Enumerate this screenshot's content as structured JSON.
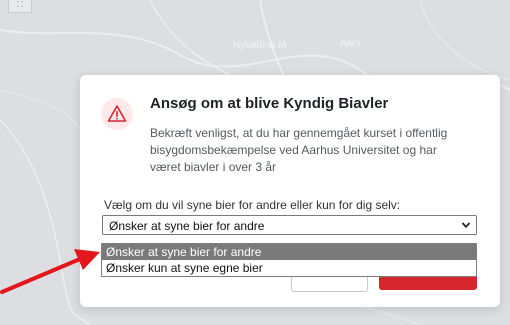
{
  "map": {
    "labels": [
      "Nykøbing M",
      "Aars"
    ],
    "corner_button_glyph": "⛶"
  },
  "dialog": {
    "title": "Ansøg om at blive Kyndig Biavler",
    "body": "Bekræft venligst, at du har gennemgået kurset i offentlig bisygdomsbekæmpelse ved Aarhus Universitet og har været biavler i over 3 år",
    "icon": "warning-triangle-icon",
    "select_label": "Vælg om du vil syne bier for andre eller kun for dig selv:",
    "select_value": "Ønsker at syne bier for andre",
    "options": [
      "Ønsker at syne bier for andre",
      "Ønsker kun at syne egne bier"
    ],
    "accent_color": "#d6262e"
  },
  "annotation": {
    "arrow_color": "#e3161b"
  }
}
